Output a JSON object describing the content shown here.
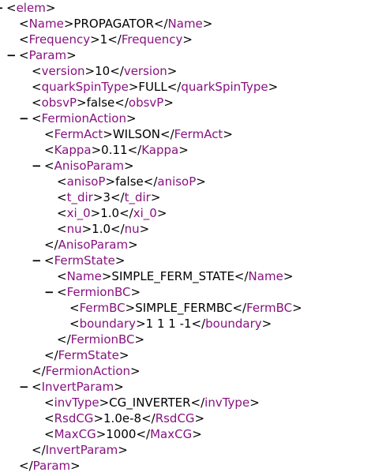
{
  "lines": [
    {
      "type": "open",
      "toggle": "−",
      "name": "elem"
    },
    {
      "type": "leaf",
      "name": "Name",
      "value": "PROPAGATOR"
    },
    {
      "type": "leaf",
      "name": "Frequency",
      "value": "1"
    },
    {
      "type": "open",
      "toggle": "−",
      "name": "Param"
    },
    {
      "type": "leaf",
      "name": "version",
      "value": "10"
    },
    {
      "type": "leaf",
      "name": "quarkSpinType",
      "value": "FULL"
    },
    {
      "type": "leaf",
      "name": "obsvP",
      "value": "false"
    },
    {
      "type": "open",
      "toggle": "−",
      "name": "FermionAction"
    },
    {
      "type": "leaf",
      "name": "FermAct",
      "value": "WILSON"
    },
    {
      "type": "leaf",
      "name": "Kappa",
      "value": "0.11"
    },
    {
      "type": "open",
      "toggle": "−",
      "name": "AnisoParam"
    },
    {
      "type": "leaf",
      "name": "anisoP",
      "value": "false"
    },
    {
      "type": "leaf",
      "name": "t_dir",
      "value": "3"
    },
    {
      "type": "leaf",
      "name": "xi_0",
      "value": "1.0"
    },
    {
      "type": "leaf",
      "name": "nu",
      "value": "1.0"
    },
    {
      "type": "close",
      "name": "AnisoParam"
    },
    {
      "type": "open",
      "toggle": "−",
      "name": "FermState"
    },
    {
      "type": "leaf",
      "name": "Name",
      "value": "SIMPLE_FERM_STATE"
    },
    {
      "type": "open",
      "toggle": "−",
      "name": "FermionBC"
    },
    {
      "type": "leaf",
      "name": "FermBC",
      "value": "SIMPLE_FERMBC"
    },
    {
      "type": "leaf",
      "name": "boundary",
      "value": "1 1 1 -1"
    },
    {
      "type": "close",
      "name": "FermionBC"
    },
    {
      "type": "close",
      "name": "FermState"
    },
    {
      "type": "close",
      "name": "FermionAction"
    },
    {
      "type": "open",
      "toggle": "−",
      "name": "InvertParam"
    },
    {
      "type": "leaf",
      "name": "invType",
      "value": "CG_INVERTER"
    },
    {
      "type": "leaf",
      "name": "RsdCG",
      "value": "1.0e-8"
    },
    {
      "type": "leaf",
      "name": "MaxCG",
      "value": "1000"
    },
    {
      "type": "close",
      "name": "InvertParam"
    },
    {
      "type": "close",
      "name": "Param"
    }
  ],
  "colors": {
    "tag_name": "#881280",
    "bracket": "#000000",
    "text": "#000000",
    "background": "#ffffff"
  },
  "icons": {
    "collapse_toggle": "minus-collapse-icon"
  }
}
